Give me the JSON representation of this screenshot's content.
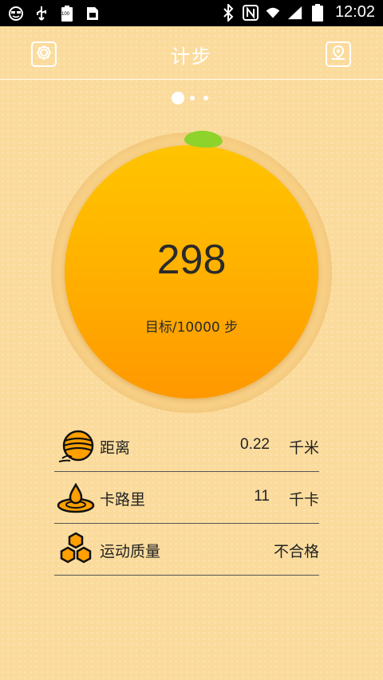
{
  "status_bar": {
    "time": "12:02",
    "battery_text": "100",
    "icons": [
      "face-icon",
      "usb-icon",
      "battery-100-icon",
      "sim-icon",
      "bluetooth-icon",
      "nfc-icon",
      "wifi-icon",
      "signal-icon",
      "battery-icon"
    ]
  },
  "header": {
    "title": "计步"
  },
  "pager": {
    "active_index": 0,
    "count": 3
  },
  "counter": {
    "steps": "298",
    "goal_text": "目标/10000 步",
    "colors": {
      "fruit_top": "#ffc400",
      "fruit_bottom": "#ff9800",
      "leaf": "#8ed22c"
    }
  },
  "stats": {
    "distance": {
      "label": "距离",
      "value": "0.22",
      "unit": "千米"
    },
    "calories": {
      "label": "卡路里",
      "value": "11",
      "unit": "千卡"
    },
    "quality": {
      "label": "运动质量",
      "value": "不合格"
    }
  }
}
